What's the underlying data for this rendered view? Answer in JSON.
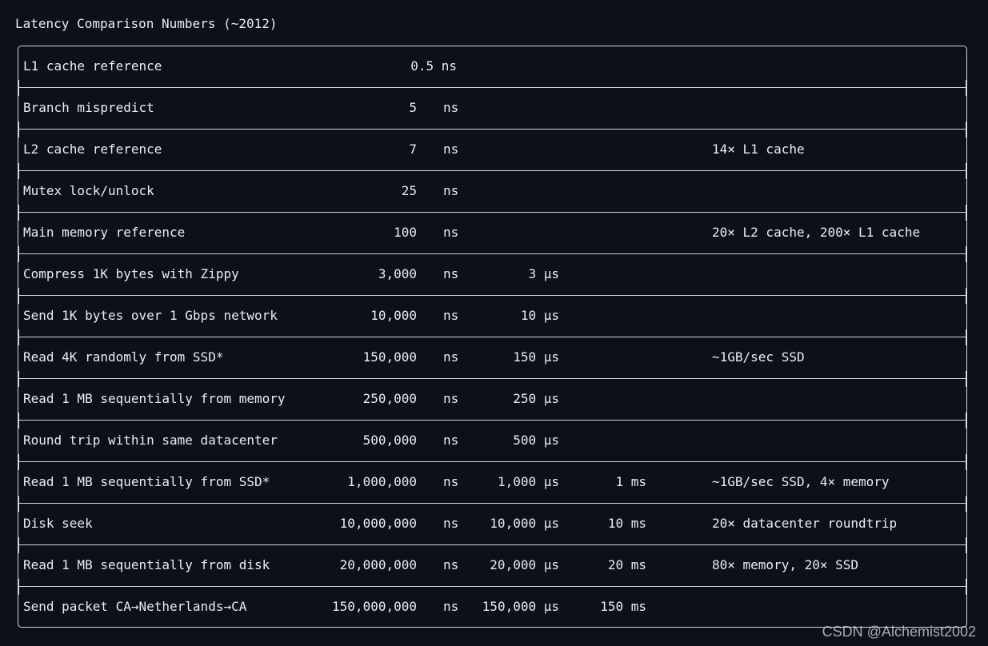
{
  "title": "Latency Comparison Numbers (~2012)",
  "rows": [
    {
      "name": "L1 cache reference",
      "ns": "0.5 ns",
      "us": "",
      "ms": "",
      "note": ""
    },
    {
      "name": "Branch mispredict",
      "ns": "5",
      "ns_unit": "ns",
      "us": "",
      "ms": "",
      "note": ""
    },
    {
      "name": "L2 cache reference",
      "ns": "7",
      "ns_unit": "ns",
      "us": "",
      "ms": "",
      "note": "14× L1 cache"
    },
    {
      "name": "Mutex lock/unlock",
      "ns": "25",
      "ns_unit": "ns",
      "us": "",
      "ms": "",
      "note": ""
    },
    {
      "name": "Main memory reference",
      "ns": "100",
      "ns_unit": "ns",
      "us": "",
      "ms": "",
      "note": "20× L2 cache, 200× L1 cache"
    },
    {
      "name": "Compress 1K bytes with Zippy",
      "ns": "3,000",
      "ns_unit": "ns",
      "us": "3 µs",
      "ms": "",
      "note": ""
    },
    {
      "name": "Send 1K bytes over 1 Gbps network",
      "ns": "10,000",
      "ns_unit": "ns",
      "us": "10 µs",
      "ms": "",
      "note": ""
    },
    {
      "name": "Read 4K randomly from SSD*",
      "ns": "150,000",
      "ns_unit": "ns",
      "us": "150 µs",
      "ms": "",
      "note": "~1GB/sec SSD"
    },
    {
      "name": "Read 1 MB sequentially from memory",
      "ns": "250,000",
      "ns_unit": "ns",
      "us": "250 µs",
      "ms": "",
      "note": ""
    },
    {
      "name": "Round trip within same datacenter",
      "ns": "500,000",
      "ns_unit": "ns",
      "us": "500 µs",
      "ms": "",
      "note": ""
    },
    {
      "name": "Read 1 MB sequentially from SSD*",
      "ns": "1,000,000",
      "ns_unit": "ns",
      "us": "1,000 µs",
      "ms": "1 ms",
      "note": "~1GB/sec SSD, 4× memory"
    },
    {
      "name": "Disk seek",
      "ns": "10,000,000",
      "ns_unit": "ns",
      "us": "10,000 µs",
      "ms": "10 ms",
      "note": "20× datacenter roundtrip"
    },
    {
      "name": "Read 1 MB sequentially from disk",
      "ns": "20,000,000",
      "ns_unit": "ns",
      "us": "20,000 µs",
      "ms": "20 ms",
      "note": "80× memory, 20× SSD"
    },
    {
      "name": "Send packet CA→Netherlands→CA",
      "ns": "150,000,000",
      "ns_unit": "ns",
      "us": "150,000 µs",
      "ms": "150 ms",
      "note": ""
    }
  ],
  "watermark": "CSDN @Alchemist2002"
}
